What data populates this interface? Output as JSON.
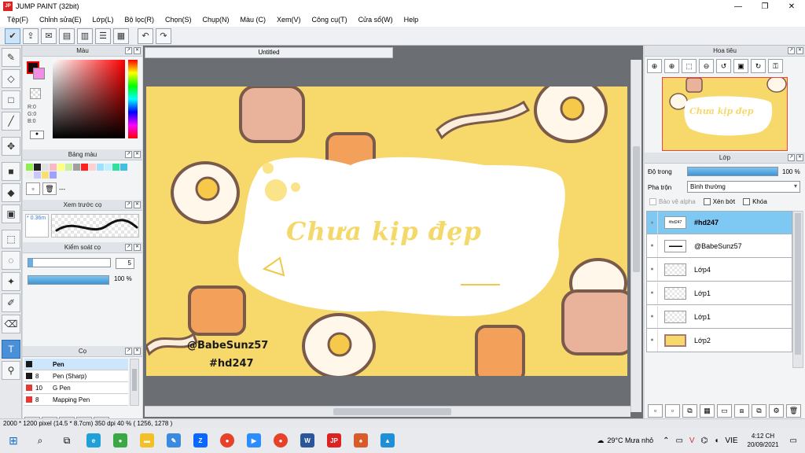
{
  "window": {
    "title": "JUMP PAINT (32bit)",
    "min": "—",
    "restore": "❐",
    "close": "✕",
    "app_badge": "JP"
  },
  "menu": [
    "Tệp(F)",
    "Chỉnh sửa(E)",
    "Lớp(L)",
    "Bộ lọc(R)",
    "Chọn(S)",
    "Chụp(N)",
    "Màu (C)",
    "Xem(V)",
    "Công cụ(T)",
    "Cửa sổ(W)",
    "Help"
  ],
  "panels": {
    "color": {
      "title": "Màu",
      "r": "R:0",
      "g": "G:0",
      "b": "B:0",
      "fg": "#1a0a0a",
      "bg": "#f08ee6"
    },
    "palette": {
      "title": "Bảng màu",
      "more": "---"
    },
    "preview": {
      "title": "Xem trước cọ",
      "size": "* 0.36m"
    },
    "control": {
      "title": "Kiểm soát cọ",
      "size": "5",
      "opacity": "100 %"
    },
    "brush": {
      "title": "Cọ",
      "items": [
        {
          "num": "",
          "name": "Pen",
          "color": "#1a1a1a"
        },
        {
          "num": "8",
          "name": "Pen (Sharp)",
          "color": "#1a1a1a"
        },
        {
          "num": "10",
          "name": "G Pen",
          "color": "#e53935"
        },
        {
          "num": "8",
          "name": "Mapping Pen",
          "color": "#e53935"
        }
      ]
    },
    "navigator": {
      "title": "Hoa tiêu",
      "mini_text": "Chưa kịp đẹp"
    },
    "layer": {
      "title": "Lớp",
      "opacity_label": "Độ trong",
      "opacity": "100 %",
      "blend_label": "Pha trộn",
      "blend": "Bình thường",
      "protect_alpha": "Bảo vệ alpha",
      "clipping": "Xén bớt",
      "lock": "Khóa",
      "thumb_text": "#hd247",
      "items": [
        {
          "name": "#hd247",
          "sel": true,
          "kind": "txt"
        },
        {
          "name": "@BabeSunz57",
          "sel": false,
          "kind": "txt"
        },
        {
          "name": "Lớp4",
          "sel": false,
          "kind": "empty"
        },
        {
          "name": "Lớp1",
          "sel": false,
          "kind": "empty"
        },
        {
          "name": "Lớp1",
          "sel": false,
          "kind": "empty"
        },
        {
          "name": "Lớp2",
          "sel": false,
          "kind": "img"
        }
      ]
    }
  },
  "document": {
    "tab": "Untitled",
    "headline": "Chưa kịp đẹp",
    "handle": "@BabeSunz57",
    "tag": "#hd247"
  },
  "palette_colors": [
    "#90ee50",
    "#222222",
    "#e0e0e0",
    "#f8b8c8",
    "#ffff80",
    "#c8f0a0",
    "#a0a0a0",
    "#ff2020",
    "#ffd0d0",
    "#a0e0ff",
    "#c0f0ff",
    "#30e0a0",
    "#40c0e0",
    "#f0f0f0",
    "#c8c8ff",
    "#f8e070",
    "#a0a0ff"
  ],
  "status": "2000 * 1200 pixel   (14.5 * 8.7cm)   350 dpi   40 %   ( 1256, 1278 )",
  "taskbar": {
    "weather": "29°C  Mưa nhỏ",
    "lang": "VIE",
    "time": "4:12 CH",
    "date": "20/09/2021"
  }
}
